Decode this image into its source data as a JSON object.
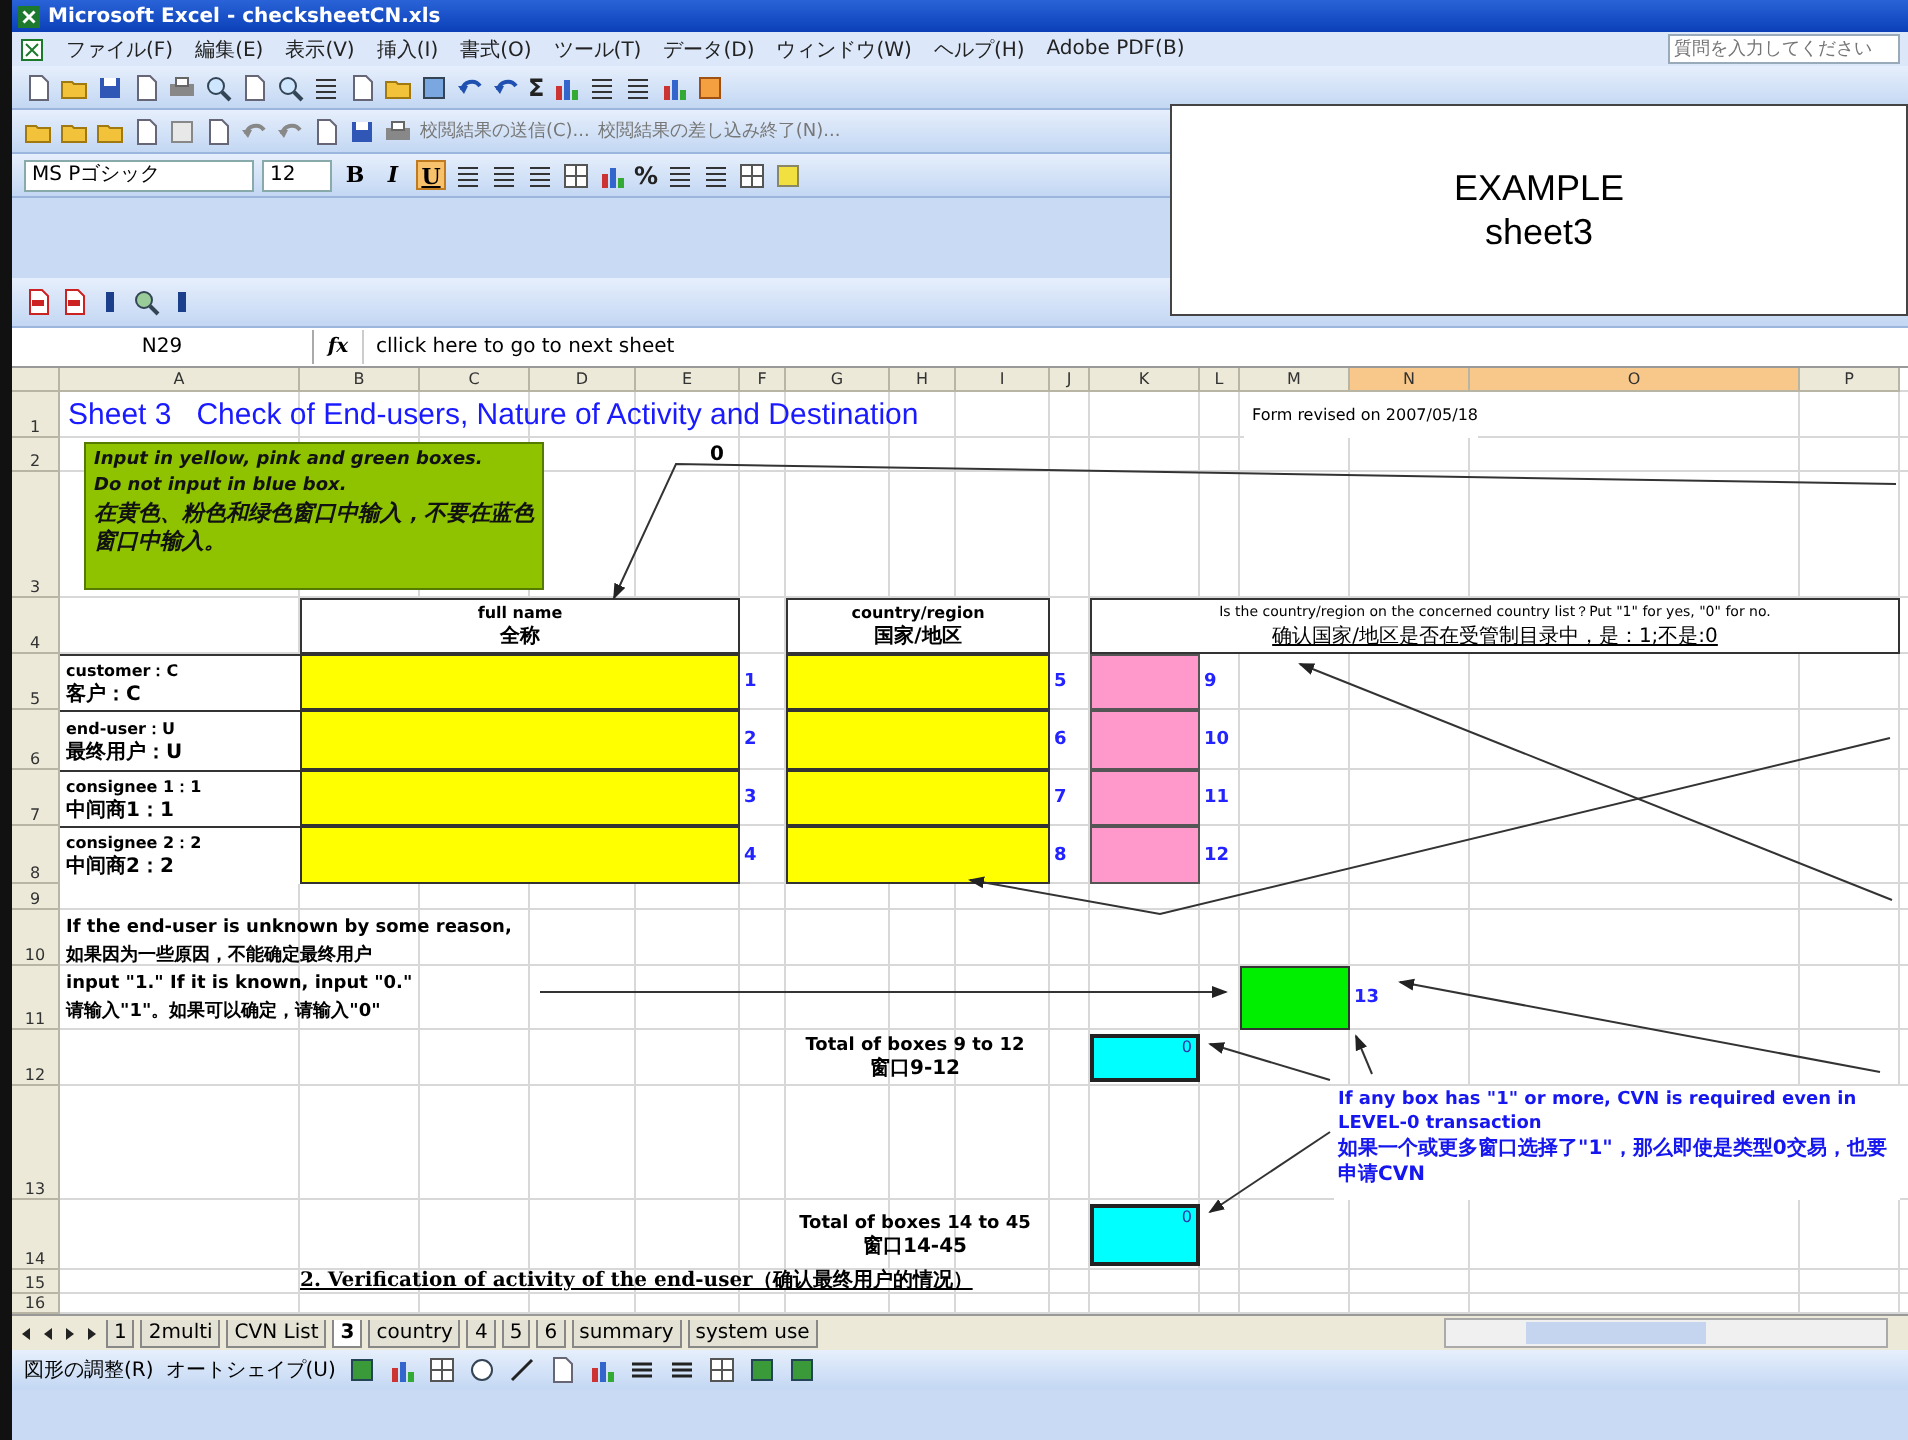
{
  "window": {
    "title": "Microsoft Excel - checksheetCN.xls"
  },
  "menu": {
    "items": [
      "ファイル(F)",
      "編集(E)",
      "表示(V)",
      "挿入(I)",
      "書式(O)",
      "ツール(T)",
      "データ(D)",
      "ウィンドウ(W)",
      "ヘルプ(H)",
      "Adobe PDF(B)"
    ],
    "help_search": {
      "placeholder": "質問を入力してください"
    }
  },
  "standard_toolbar": {
    "sum": "Σ"
  },
  "review_toolbar": {
    "items": [
      "校閲結果の送信(C)...",
      "校閲結果の差し込み終了(N)..."
    ]
  },
  "formatting_toolbar": {
    "font": "MS Pゴシック",
    "size": "12",
    "styles": [
      {
        "label": "B",
        "on": false
      },
      {
        "label": "I",
        "on": false
      },
      {
        "label": "U",
        "on": true
      }
    ],
    "percent": "%"
  },
  "overlay_note": {
    "lines": [
      "EXAMPLE",
      "sheet3"
    ]
  },
  "formula_bar": {
    "name_box": "N29",
    "function_label": "fx",
    "content": "cllick here to go to next sheet"
  },
  "sheet": {
    "column_headers": [
      {
        "label": "A",
        "selected": false
      },
      {
        "label": "B",
        "selected": false
      },
      {
        "label": "C",
        "selected": false
      },
      {
        "label": "D",
        "selected": false
      },
      {
        "label": "E",
        "selected": false
      },
      {
        "label": "F",
        "selected": false
      },
      {
        "label": "G",
        "selected": false
      },
      {
        "label": "H",
        "selected": false
      },
      {
        "label": "I",
        "selected": false
      },
      {
        "label": "J",
        "selected": false
      },
      {
        "label": "K",
        "selected": false
      },
      {
        "label": "L",
        "selected": false
      },
      {
        "label": "M",
        "selected": false
      },
      {
        "label": "N",
        "selected": true
      },
      {
        "label": "O",
        "selected": true
      },
      {
        "label": "P",
        "selected": false
      }
    ],
    "row_numbers": [
      "1",
      "2",
      "3",
      "4",
      "5",
      "6",
      "7",
      "8",
      "9",
      "10",
      "11",
      "12",
      "13",
      "14",
      "15",
      "16"
    ],
    "title": "Sheet 3   Check of End-users, Nature of Activity and Destination",
    "revised": "Form revised on 2007/05/18",
    "instruction": [
      "Input in yellow, pink and green boxes.",
      "Do not input in blue box.",
      "在黄色、粉色和绿色窗口中输入，不要在蓝色窗口中输入。"
    ],
    "top_value": "0",
    "headers": [
      {
        "en": "full name",
        "zh": "全称"
      },
      {
        "en": "country/region",
        "zh": "国家/地区"
      },
      {
        "en": "Is the country/region on the concerned country list？Put \"1\" for yes, \"0\" for no.",
        "zh": "确认国家/地区是否在受管制目录中，是：1;不是:0"
      }
    ],
    "parties": [
      {
        "en": "customer：C",
        "zh": "客户：C",
        "name_no": "1",
        "country_no": "5",
        "list_no": "9"
      },
      {
        "en": "end-user：U",
        "zh": "最终用户：U",
        "name_no": "2",
        "country_no": "6",
        "list_no": "10"
      },
      {
        "en": "consignee 1：1",
        "zh": "中间商1：1",
        "name_no": "3",
        "country_no": "7",
        "list_no": "11"
      },
      {
        "en": "consignee 2：2",
        "zh": "中间商2：2",
        "name_no": "4",
        "country_no": "8",
        "list_no": "12"
      }
    ],
    "unknown_note": [
      "If the end-user is unknown by some reason,",
      "如果因为一些原因，不能确定最终用户",
      "input \"1.\" If it is known, input \"0.\"",
      "请输入\"1\"。如果可以确定，请输入\"0\""
    ],
    "green_no": "13",
    "totals": [
      {
        "en": "Total of boxes 9 to 12",
        "zh": "窗口9-12",
        "value": "0"
      },
      {
        "en": "Total of boxes 14 to 45",
        "zh": "窗口14-45",
        "value": "0"
      }
    ],
    "cvn_note": [
      "If any box has \"1\" or more, CVN is required even in LEVEL-0 transaction",
      "如果一个或更多窗口选择了\"1\"，那么即使是类型0交易，也要申请CVN"
    ],
    "section_heading": "2. Verification of activity of the end-user（确认最终用户的情况）"
  },
  "sheet_tabs": [
    {
      "label": "1",
      "selected": false
    },
    {
      "label": "2multi",
      "selected": false
    },
    {
      "label": "CVN List",
      "selected": false
    },
    {
      "label": "3",
      "selected": true
    },
    {
      "label": "country",
      "selected": false
    },
    {
      "label": "4",
      "selected": false
    },
    {
      "label": "5",
      "selected": false
    },
    {
      "label": "6",
      "selected": false
    },
    {
      "label": "summary",
      "selected": false
    },
    {
      "label": "system use",
      "selected": false
    }
  ],
  "drawing_toolbar": {
    "items": [
      "図形の調整(R)",
      "オートシェイプ(U)"
    ]
  }
}
